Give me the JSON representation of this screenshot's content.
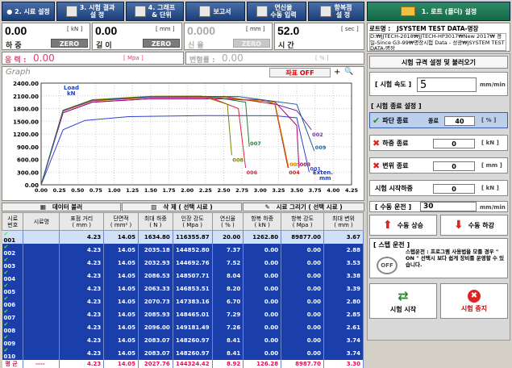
{
  "toolbar": {
    "btn1": "2. 시료 설정",
    "btn2": "3. 시험 결과\n설 정",
    "btn3": "4. 그래프\n& 단위",
    "btn4": "보고서",
    "btn5": "연신율\n수동 입력",
    "btn6": "항복점\n설 정",
    "btn_right": "1. 로트 (폴더) 설정"
  },
  "readouts": {
    "load": {
      "value": "0.00",
      "unit": "[ kN ]",
      "label": "하 중",
      "zero": "ZERO"
    },
    "disp": {
      "value": "0.00",
      "unit": "[ mm ]",
      "label": "길 이",
      "zero": "ZERO"
    },
    "ext": {
      "value": "0.000",
      "unit": "[ mm ]",
      "label": "신 율",
      "zero": "ZERO"
    },
    "time": {
      "value": "52.0",
      "unit": "[ sec ]",
      "label": "시 간"
    },
    "stress": {
      "label": "응 력 :",
      "value": "0.00",
      "unit": "[ Mpa ]"
    },
    "strain": {
      "label": "변형률 :",
      "value": "0.00",
      "unit": "[ % ]"
    }
  },
  "lot": {
    "label": "로트명 :",
    "name": "JSYSTEM TEST DATA-명장",
    "path": "D:₩JJTECH-2018₩JJTECH-HP3017₩New 2017₩ 경일-Since G3-99₩명장시험 Data - 성광₩JSYSTEM TEST DATA-명장"
  },
  "right": {
    "spec_button": "시험 규격 설정 및 불러오기",
    "speed_label": "[ 시험 속도 ]",
    "speed_value": "5",
    "speed_unit": "mm/min",
    "end_group": "[ 시험 종료 설정 ]",
    "break": {
      "label": "파단 종료",
      "sub": "종료",
      "value": "40",
      "unit": "[ % ]"
    },
    "load_end": {
      "label": "하중 종료",
      "value": "0",
      "unit": "[ kN ]"
    },
    "disp_end": {
      "label": "변위 종료",
      "value": "0",
      "unit": "[ mm ]"
    },
    "start_load": {
      "label": "시험 시작하중",
      "value": "0",
      "unit": "[ kN ]"
    },
    "manual": {
      "label": "[ 수동 운전 ]",
      "value": "30",
      "unit": "mm/min"
    },
    "up": "수동 상승",
    "down": "수동 하강",
    "step": {
      "title": "[ 스텝 운전 ]",
      "text": "스텝운전 : 프로그램 사용법을 모를 경우 \" ON \" 선택시 보다 쉽게 장비를 운영할 수 있습니다.",
      "toggle": "OFF"
    },
    "start": "시험 시작",
    "stop": "시험 중지"
  },
  "graph": {
    "title": "Graph",
    "coord_button": "좌표  OFF",
    "plus": "+"
  },
  "bottom": {
    "data_load": "데이터 불러",
    "delete": "삭 제 ( 선택 시료 )",
    "draw": "시료 그리기 ( 선택 시료 )"
  },
  "table": {
    "headers": [
      "시료\n번호",
      "시료명",
      "표점 거리\n( mm )",
      "단면적\n( mm² )",
      "최대 하중\n( N )",
      "인장 강도\n( Mpa )",
      "연신율\n( % )",
      "항복 하중\n( kN )",
      "항복 강도\n( Mpa )",
      "최대 변위\n( mm )"
    ],
    "rows": [
      [
        "001",
        "",
        "4.23",
        "14.05",
        "1634.80",
        "116355.87",
        "20.00",
        "1262.80",
        "89877.00",
        "3.67"
      ],
      [
        "002",
        "",
        "4.23",
        "14.05",
        "2035.18",
        "144852.80",
        "7.37",
        "0.00",
        "0.00",
        "2.88"
      ],
      [
        "003",
        "",
        "4.23",
        "14.05",
        "2032.93",
        "144692.76",
        "7.52",
        "0.00",
        "0.00",
        "3.53"
      ],
      [
        "004",
        "",
        "4.23",
        "14.05",
        "2086.53",
        "148507.71",
        "8.04",
        "0.00",
        "0.00",
        "3.38"
      ],
      [
        "005",
        "",
        "4.23",
        "14.05",
        "2063.33",
        "146853.51",
        "8.20",
        "0.00",
        "0.00",
        "3.39"
      ],
      [
        "006",
        "",
        "4.23",
        "14.05",
        "2070.73",
        "147383.16",
        "6.70",
        "0.00",
        "0.00",
        "2.80"
      ],
      [
        "007",
        "",
        "4.23",
        "14.05",
        "2085.93",
        "148465.01",
        "7.29",
        "0.00",
        "0.00",
        "2.85"
      ],
      [
        "008",
        "",
        "4.23",
        "14.05",
        "2096.00",
        "149181.49",
        "7.26",
        "0.00",
        "0.00",
        "2.61"
      ],
      [
        "009",
        "",
        "4.23",
        "14.05",
        "2083.07",
        "148260.97",
        "8.41",
        "0.00",
        "0.00",
        "3.74"
      ],
      [
        "010",
        "",
        "4.23",
        "14.05",
        "2083.07",
        "148260.97",
        "8.41",
        "0.00",
        "0.00",
        "3.74"
      ]
    ],
    "avg": [
      "평 균",
      "----",
      "4.23",
      "14.05",
      "2027.76",
      "144324.42",
      "8.92",
      "126.28",
      "8987.70",
      "3.30"
    ]
  },
  "chart_data": {
    "type": "line",
    "ylabel": "Load kN",
    "xlabel": "Exten. mm",
    "xlim": [
      0,
      4.25
    ],
    "ylim": [
      0,
      2400
    ],
    "x_ticks": [
      "0.00",
      "0.25",
      "0.50",
      "0.75",
      "1.00",
      "1.25",
      "1.50",
      "1.75",
      "2.00",
      "2.25",
      "2.50",
      "2.75",
      "3.00",
      "3.25",
      "3.50",
      "3.75",
      "4.00",
      "4.25"
    ],
    "y_ticks": [
      "2400.00",
      "2100.00",
      "1800.00",
      "1500.00",
      "1200.00",
      "900.00",
      "600.00",
      "300.00",
      "0.00"
    ],
    "series": [
      {
        "name": "001",
        "color": "#3040d0",
        "points": [
          [
            0,
            0
          ],
          [
            0.3,
            1300
          ],
          [
            0.6,
            1520
          ],
          [
            1.2,
            1610
          ],
          [
            2.2,
            1635
          ],
          [
            3.2,
            1630
          ],
          [
            3.5,
            1580
          ],
          [
            3.67,
            300
          ]
        ]
      },
      {
        "name": "002",
        "color": "#7030a0",
        "points": [
          [
            0,
            0
          ],
          [
            0.3,
            1700
          ],
          [
            0.7,
            1950
          ],
          [
            1.5,
            2030
          ],
          [
            2.3,
            2035
          ],
          [
            3.0,
            2010
          ],
          [
            3.5,
            1750
          ],
          [
            3.7,
            1300
          ]
        ]
      },
      {
        "name": "003",
        "color": "#b00070",
        "points": [
          [
            0,
            0
          ],
          [
            0.3,
            1700
          ],
          [
            0.7,
            1950
          ],
          [
            1.5,
            2030
          ],
          [
            2.5,
            2030
          ],
          [
            3.2,
            1960
          ],
          [
            3.5,
            1400
          ],
          [
            3.53,
            400
          ]
        ]
      },
      {
        "name": "004",
        "color": "#c02020",
        "points": [
          [
            0,
            0
          ],
          [
            0.3,
            1750
          ],
          [
            0.7,
            2000
          ],
          [
            1.5,
            2080
          ],
          [
            2.5,
            2085
          ],
          [
            3.2,
            1900
          ],
          [
            3.38,
            400
          ]
        ]
      },
      {
        "name": "005",
        "color": "#d08000",
        "points": [
          [
            0,
            0
          ],
          [
            0.3,
            1740
          ],
          [
            0.7,
            1980
          ],
          [
            1.5,
            2060
          ],
          [
            2.5,
            2060
          ],
          [
            3.2,
            1950
          ],
          [
            3.39,
            400
          ]
        ]
      },
      {
        "name": "006",
        "color": "#e02040",
        "points": [
          [
            0,
            0
          ],
          [
            0.3,
            1740
          ],
          [
            0.7,
            1990
          ],
          [
            1.5,
            2065
          ],
          [
            2.3,
            2070
          ],
          [
            2.7,
            1800
          ],
          [
            2.8,
            400
          ]
        ]
      },
      {
        "name": "007",
        "color": "#208030",
        "points": [
          [
            0,
            0
          ],
          [
            0.3,
            1760
          ],
          [
            0.7,
            2000
          ],
          [
            1.5,
            2080
          ],
          [
            2.3,
            2085
          ],
          [
            2.8,
            1950
          ],
          [
            2.85,
            900
          ]
        ]
      },
      {
        "name": "008",
        "color": "#808000",
        "points": [
          [
            0,
            0
          ],
          [
            0.3,
            1760
          ],
          [
            0.7,
            2010
          ],
          [
            1.5,
            2090
          ],
          [
            2.2,
            2096
          ],
          [
            2.55,
            1900
          ],
          [
            2.61,
            700
          ]
        ]
      },
      {
        "name": "009",
        "color": "#206090",
        "points": [
          [
            0,
            0
          ],
          [
            0.3,
            1750
          ],
          [
            0.7,
            1995
          ],
          [
            1.5,
            2075
          ],
          [
            2.7,
            2083
          ],
          [
            3.5,
            1900
          ],
          [
            3.74,
            800
          ]
        ]
      }
    ]
  }
}
